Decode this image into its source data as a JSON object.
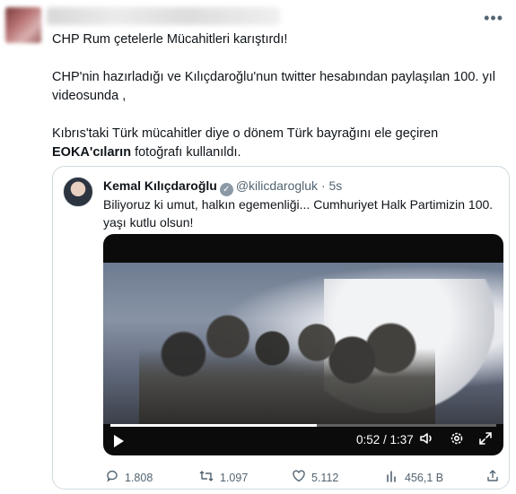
{
  "tweet": {
    "more_icon": "more-horizontal-icon",
    "paragraphs": [
      "CHP Rum çetelerle Mücahitleri karıştırdı!",
      "CHP'nin hazırladığı ve Kılıçdaroğlu'nun twitter hesabından paylaşılan 100. yıl videosunda ,",
      {
        "before": "Kıbrıs'taki Türk mücahitler diye o dönem Türk bayrağını ele geçiren ",
        "bold": "EOKA'cıların",
        "after": " fotoğrafı kullanıldı."
      }
    ]
  },
  "quote": {
    "name": "Kemal Kılıçdaroğlu",
    "handle": "@kilicdarogluk",
    "separator": "·",
    "time": "5s",
    "text": "Biliyoruz ki umut, halkın egemenliği... Cumhuriyet Halk Partimizin 100. yaşı kutlu olsun!",
    "video": {
      "current_time": "0:52",
      "total_time": "1:37",
      "time_display": "0:52 / 1:37",
      "progress": 0.536,
      "controls": [
        "play-icon",
        "volume-icon",
        "settings-icon",
        "fullscreen-icon"
      ]
    },
    "actions": {
      "replies": "1.808",
      "retweets": "1.097",
      "likes": "5.112",
      "views": "456,1 B"
    }
  }
}
